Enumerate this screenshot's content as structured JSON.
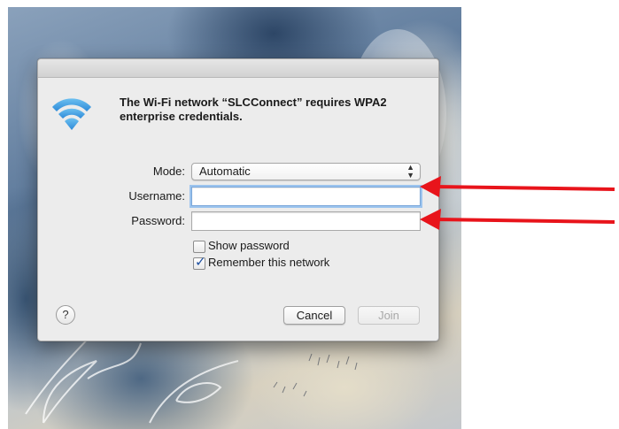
{
  "dialog": {
    "message": "The Wi-Fi network “SLCConnect” requires WPA2 enterprise credentials.",
    "icon": "wifi-icon",
    "mode": {
      "label": "Mode:",
      "value": "Automatic"
    },
    "username": {
      "label": "Username:",
      "value": ""
    },
    "password": {
      "label": "Password:",
      "value": ""
    },
    "show_password": {
      "label": "Show password",
      "checked": false
    },
    "remember_network": {
      "label": "Remember this network",
      "checked": true
    },
    "help_label": "?",
    "cancel_label": "Cancel",
    "join_label": "Join"
  },
  "annotations": {
    "arrow_color": "#e8141b"
  }
}
